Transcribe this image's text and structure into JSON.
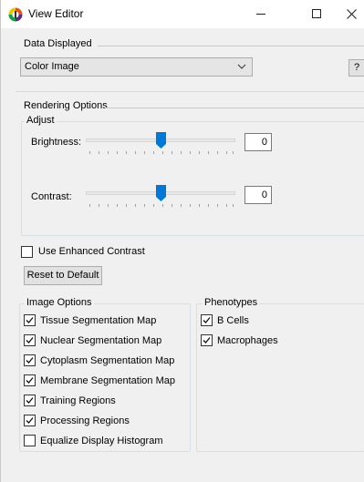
{
  "window": {
    "title": "View Editor"
  },
  "data_displayed": {
    "group_title": "Data Displayed",
    "selected": "Color Image",
    "help_label": "?"
  },
  "rendering": {
    "group_title": "Rendering Options",
    "adjust_title": "Adjust",
    "brightness": {
      "label": "Brightness:",
      "value": "0",
      "level": 0.5
    },
    "contrast": {
      "label": "Contrast:",
      "value": "0",
      "level": 0.5
    }
  },
  "enhanced_contrast": {
    "label": "Use Enhanced Contrast",
    "checked": false
  },
  "reset_button": {
    "label": "Reset to Default"
  },
  "image_options": {
    "group_title": "Image Options",
    "items": [
      {
        "label": "Tissue Segmentation Map",
        "checked": true
      },
      {
        "label": "Nuclear Segmentation Map",
        "checked": true
      },
      {
        "label": "Cytoplasm Segmentation Map",
        "checked": true
      },
      {
        "label": "Membrane Segmentation Map",
        "checked": true
      },
      {
        "label": "Training Regions",
        "checked": true
      },
      {
        "label": "Processing Regions",
        "checked": true
      },
      {
        "label": "Equalize Display Histogram",
        "checked": false
      }
    ]
  },
  "phenotypes": {
    "group_title": "Phenotypes",
    "items": [
      {
        "label": "B Cells",
        "checked": true
      },
      {
        "label": "Macrophages",
        "checked": true
      }
    ]
  },
  "colors": {
    "slider_thumb": "#0078d7",
    "window_bg": "#f0f0f0"
  }
}
